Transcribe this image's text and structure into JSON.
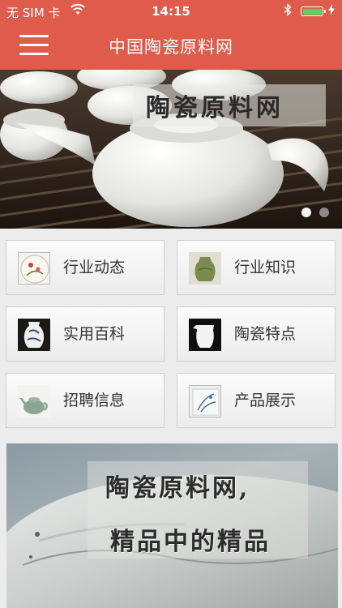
{
  "status_bar": {
    "carrier": "无 SIM 卡",
    "time": "14:15",
    "battery_level": 1.0
  },
  "header": {
    "title": "中国陶瓷原料网"
  },
  "banner": {
    "overlay_text": "陶瓷原料网",
    "slide_count": 2,
    "active_slide": 1
  },
  "categories": [
    {
      "label": "行业动态",
      "icon": "painted-plate-icon"
    },
    {
      "label": "行业知识",
      "icon": "jar-icon"
    },
    {
      "label": "实用百科",
      "icon": "blue-white-vase-icon"
    },
    {
      "label": "陶瓷特点",
      "icon": "white-pitcher-icon"
    },
    {
      "label": "招聘信息",
      "icon": "teapot-icon"
    },
    {
      "label": "产品展示",
      "icon": "orchid-plate-icon"
    }
  ],
  "promo": {
    "line1": "陶瓷原料网,",
    "line2": "精品中的精品"
  },
  "colors": {
    "header_bg": "#df5b4b",
    "battery_fill": "#4cd964"
  }
}
